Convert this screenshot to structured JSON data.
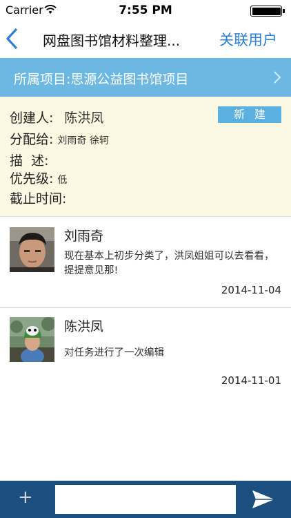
{
  "status_bar": {
    "carrier": "Carrier",
    "time": "7:55 PM"
  },
  "nav": {
    "title": "网盘图书馆材料整理...",
    "action": "关联用户"
  },
  "project": {
    "label": "所属项目:思源公益图书馆项目"
  },
  "task": {
    "creator_label": "创建人:",
    "creator": "陈洪凤",
    "status_button": "新建",
    "assignee_label": "分配给:",
    "assignees": "刘雨奇 徐轲",
    "description_label": "描  述:",
    "description": "",
    "priority_label": "优先级:",
    "priority": "低",
    "deadline_label": "截止时间:",
    "deadline": ""
  },
  "comments": [
    {
      "author": "刘雨奇",
      "text": "现在基本上初步分类了，洪凤姐姐可以去看看，提提意见那!",
      "date": "2014-11-04"
    },
    {
      "author": "陈洪凤",
      "text": "对任务进行了一次编辑",
      "date": "2014-11-01"
    }
  ],
  "composer": {
    "add_label": "+",
    "value": "",
    "placeholder": ""
  },
  "colors": {
    "accent": "#2a7fd9",
    "project_bar": "#6cb8e3",
    "info_bg": "#fcf8e2",
    "status_button": "#5ab0e0",
    "input_bar": "#1b4f7e"
  },
  "icons": {
    "back": "chevron-left-icon",
    "wifi": "wifi-icon",
    "battery": "battery-icon",
    "project_chevron": "chevron-right-icon",
    "send": "send-icon"
  }
}
